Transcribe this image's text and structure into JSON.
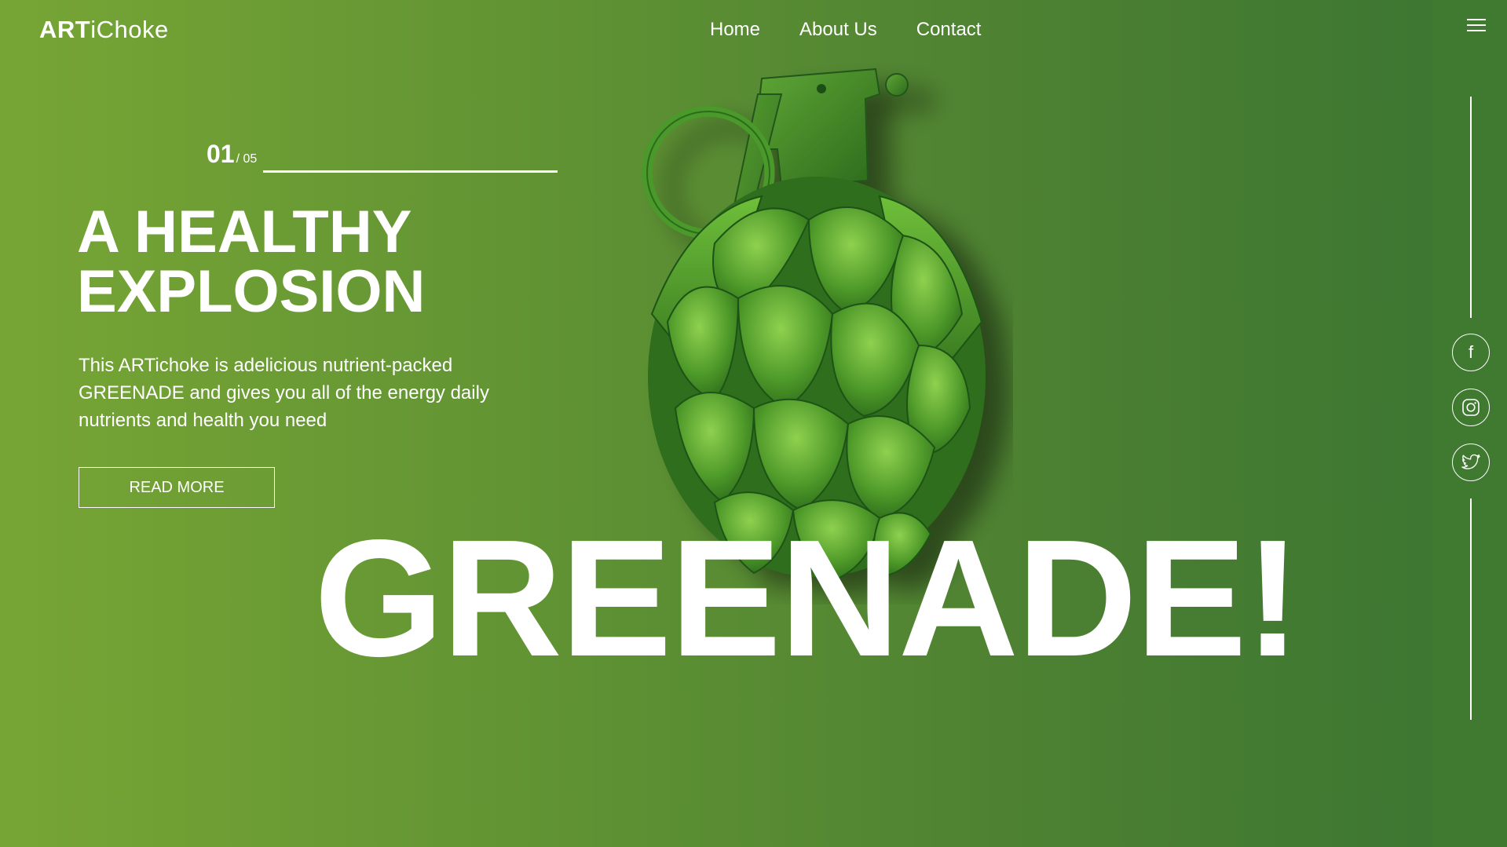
{
  "brand": {
    "logo_strong": "ART",
    "logo_light": "iChoke"
  },
  "nav": {
    "items": [
      "Home",
      "About Us",
      "Contact"
    ]
  },
  "slider": {
    "current": "01",
    "total": "/ 05"
  },
  "hero": {
    "headline_line1": "A HEALTHY",
    "headline_line2": "EXPLOSION",
    "description": "This ARTichoke is adelicious nutrient-packed GREENADE and gives you all of the energy daily nutrients and health you need",
    "button_label": "READ MORE",
    "big_word": "GREENADE!"
  },
  "social": {
    "facebook_glyph": "f",
    "icons": [
      "facebook-icon",
      "instagram-icon",
      "twitter-icon"
    ]
  },
  "colors": {
    "background_start": "#77a535",
    "background_end": "#3a7531",
    "rail": "#3f7a30",
    "text": "#ffffff"
  }
}
